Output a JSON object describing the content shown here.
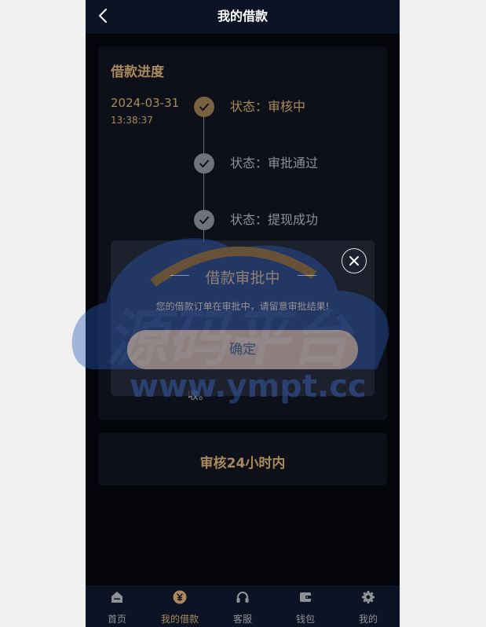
{
  "header": {
    "title": "我的借款"
  },
  "progress": {
    "title": "借款进度",
    "date": "2024-03-31",
    "time": "13:38:37",
    "steps": [
      {
        "label": "状态：审核中"
      },
      {
        "label": "状态：审批通过"
      },
      {
        "label": "状态：提现成功"
      }
    ],
    "note": "收。"
  },
  "review_card": {
    "text": "审核24小时内"
  },
  "modal": {
    "title": "借款审批中",
    "message": "您的借款订单在审批中，请留意审批结果!",
    "confirm_label": "确定"
  },
  "tabbar": {
    "items": [
      {
        "label": "首页",
        "icon": "home-icon"
      },
      {
        "label": "我的借款",
        "icon": "yuan-coin-icon"
      },
      {
        "label": "客服",
        "icon": "headset-icon"
      },
      {
        "label": "钱包",
        "icon": "wallet-icon"
      },
      {
        "label": "我的",
        "icon": "gear-icon"
      }
    ],
    "active_index": 1
  },
  "watermark": {
    "logo_text": "源码平台",
    "url_text": "www.ympt.cc"
  },
  "colors": {
    "accent": "#a88a5c",
    "modal_title": "#d69b4a",
    "button": "#cf9a57",
    "background": "#03050b",
    "header": "#0c1324"
  }
}
